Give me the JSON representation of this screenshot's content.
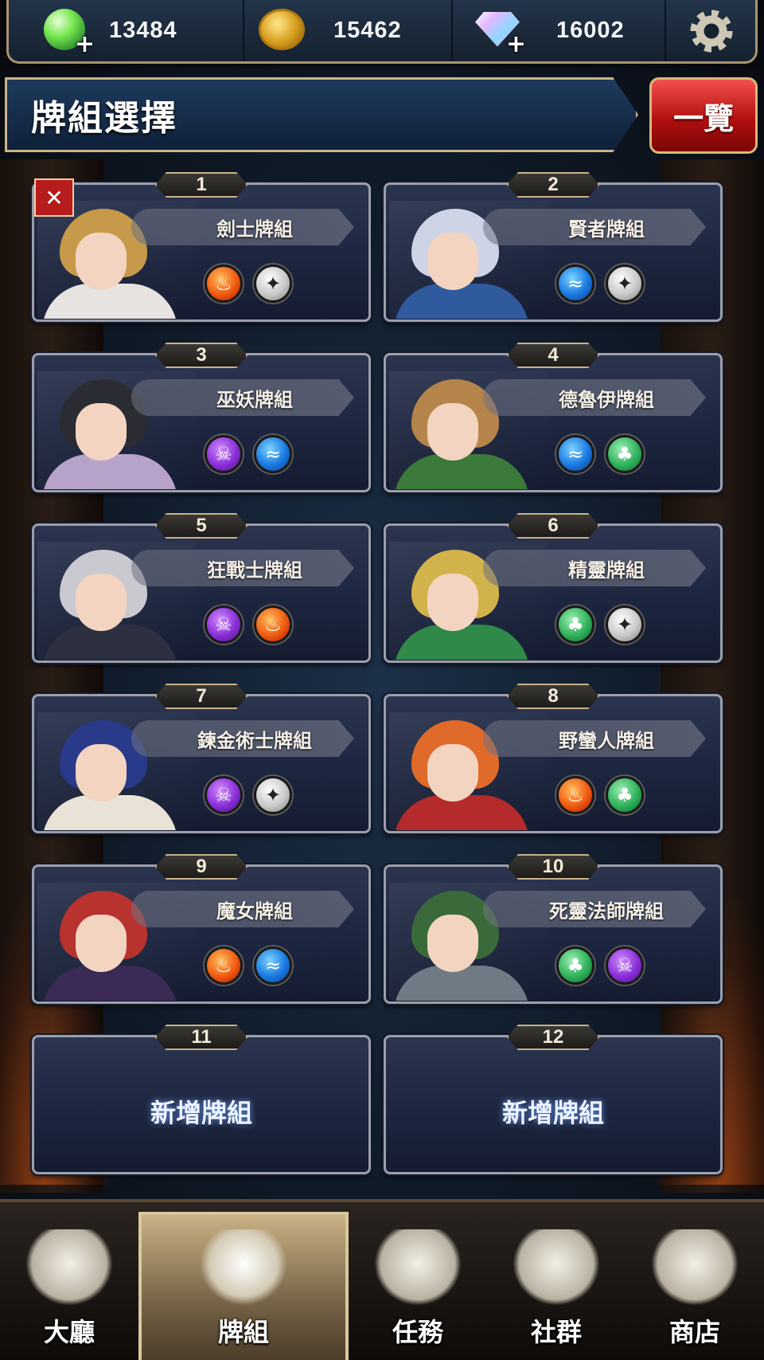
{
  "resources": {
    "stamina": {
      "value": "13484",
      "icon": "green-orb-icon",
      "action": "+"
    },
    "gold": {
      "value": "15462",
      "icon": "gold-coin-icon"
    },
    "gems": {
      "value": "16002",
      "icon": "diamond-icon",
      "action": "+"
    }
  },
  "header": {
    "title": "牌組選擇",
    "list_button": "一覽"
  },
  "decks": [
    {
      "number": "1",
      "name": "劍士牌組",
      "elements": [
        "fire",
        "neutral"
      ],
      "badge": "✕"
    },
    {
      "number": "2",
      "name": "賢者牌組",
      "elements": [
        "water",
        "neutral"
      ]
    },
    {
      "number": "3",
      "name": "巫妖牌組",
      "elements": [
        "dark",
        "water"
      ]
    },
    {
      "number": "4",
      "name": "德魯伊牌組",
      "elements": [
        "water",
        "nature"
      ]
    },
    {
      "number": "5",
      "name": "狂戰士牌組",
      "elements": [
        "dark",
        "fire"
      ]
    },
    {
      "number": "6",
      "name": "精靈牌組",
      "elements": [
        "nature",
        "neutral"
      ]
    },
    {
      "number": "7",
      "name": "鍊金術士牌組",
      "elements": [
        "dark",
        "neutral"
      ]
    },
    {
      "number": "8",
      "name": "野蠻人牌組",
      "elements": [
        "fire",
        "nature"
      ]
    },
    {
      "number": "9",
      "name": "魔女牌組",
      "elements": [
        "fire",
        "water"
      ]
    },
    {
      "number": "10",
      "name": "死靈法師牌組",
      "elements": [
        "nature",
        "dark"
      ]
    },
    {
      "number": "11",
      "name": "新增牌組",
      "empty": true
    },
    {
      "number": "12",
      "name": "新增牌組",
      "empty": true
    }
  ],
  "nav": [
    {
      "label": "大廳",
      "icon": "castle-icon"
    },
    {
      "label": "牌組",
      "icon": "cards-icon",
      "active": true
    },
    {
      "label": "任務",
      "icon": "scroll-icon"
    },
    {
      "label": "社群",
      "icon": "social-icon"
    },
    {
      "label": "商店",
      "icon": "shop-bag-icon"
    }
  ],
  "colors": {
    "accent_gold": "#c9b58a",
    "list_button_red": "#d22020",
    "panel_navy": "#1e2741"
  }
}
